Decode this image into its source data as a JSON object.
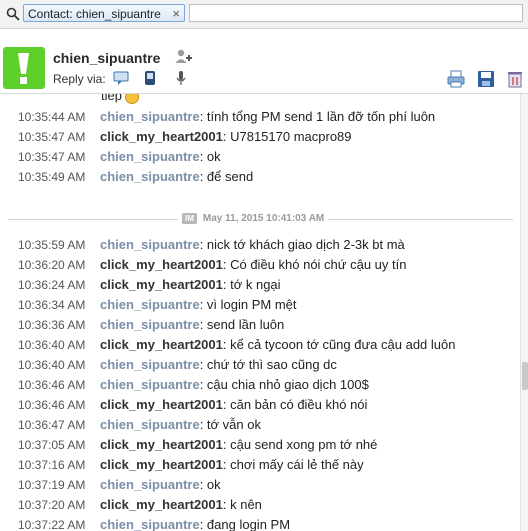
{
  "filter": {
    "chip_label": "Contact: chien_sipuantre",
    "chip_close": "×",
    "search_value": ""
  },
  "header": {
    "contact_name": "chien_sipuantre",
    "reply_via_label": "Reply via:"
  },
  "partial_line": "tiep",
  "divider": {
    "tag": "IM",
    "label": "May 11, 2015 10:41:03 AM"
  },
  "messages_before": [
    {
      "time": "10:35:44 AM",
      "nick": "chien_sipuantre",
      "text": ": tính tổng PM send 1 lần đỡ tốn phí luôn",
      "from": "them"
    },
    {
      "time": "10:35:47 AM",
      "nick": "click_my_heart2001",
      "text": ": U7815170 macpro89",
      "from": "me"
    },
    {
      "time": "10:35:47 AM",
      "nick": "chien_sipuantre",
      "text": ": ok",
      "from": "them"
    },
    {
      "time": "10:35:49 AM",
      "nick": "chien_sipuantre",
      "text": ": để send",
      "from": "them"
    }
  ],
  "messages_after": [
    {
      "time": "10:35:59 AM",
      "nick": "chien_sipuantre",
      "text": ": nick tớ khách giao dịch 2-3k bt mà",
      "from": "them"
    },
    {
      "time": "10:36:20 AM",
      "nick": "click_my_heart2001",
      "text": ": Có điều khó nói chứ cậu uy tín",
      "from": "me"
    },
    {
      "time": "10:36:24 AM",
      "nick": "click_my_heart2001",
      "text": ": tớ k ngại",
      "from": "me"
    },
    {
      "time": "10:36:34 AM",
      "nick": "chien_sipuantre",
      "text": ": vì login PM mệt",
      "from": "them"
    },
    {
      "time": "10:36:36 AM",
      "nick": "chien_sipuantre",
      "text": ": send lần luôn",
      "from": "them"
    },
    {
      "time": "10:36:40 AM",
      "nick": "click_my_heart2001",
      "text": ": kể cả tycoon tớ cũng đưa cậu add luôn",
      "from": "me"
    },
    {
      "time": "10:36:40 AM",
      "nick": "chien_sipuantre",
      "text": ": chứ tớ thì sao cũng dc",
      "from": "them"
    },
    {
      "time": "10:36:46 AM",
      "nick": "chien_sipuantre",
      "text": ": cậu chia nhỏ giao dịch 100$",
      "from": "them"
    },
    {
      "time": "10:36:46 AM",
      "nick": "click_my_heart2001",
      "text": ": căn bản có điều khó nói",
      "from": "me"
    },
    {
      "time": "10:36:47 AM",
      "nick": "chien_sipuantre",
      "text": ": tớ vẫn ok",
      "from": "them"
    },
    {
      "time": "10:37:05 AM",
      "nick": "click_my_heart2001",
      "text": ": cậu send xong pm tớ nhé",
      "from": "me"
    },
    {
      "time": "10:37:16 AM",
      "nick": "click_my_heart2001",
      "text": ": chơi mấy cái lẻ thế này",
      "from": "me"
    },
    {
      "time": "10:37:19 AM",
      "nick": "chien_sipuantre",
      "text": ": ok",
      "from": "them"
    },
    {
      "time": "10:37:20 AM",
      "nick": "click_my_heart2001",
      "text": ": k nên",
      "from": "me"
    },
    {
      "time": "10:37:22 AM",
      "nick": "chien_sipuantre",
      "text": ": đang login PM",
      "from": "them"
    }
  ],
  "colors": {
    "nick_them": "#7a8fa8",
    "nick_me": "#333333",
    "avatar": "#5fcf2a",
    "accent": "#2f6fb5"
  },
  "icons": [
    "search-icon",
    "close-icon",
    "avatar-exclamation-icon",
    "add-contact-icon",
    "im-reply-icon",
    "sms-reply-icon",
    "voice-reply-icon",
    "print-icon",
    "save-icon",
    "delete-icon"
  ]
}
